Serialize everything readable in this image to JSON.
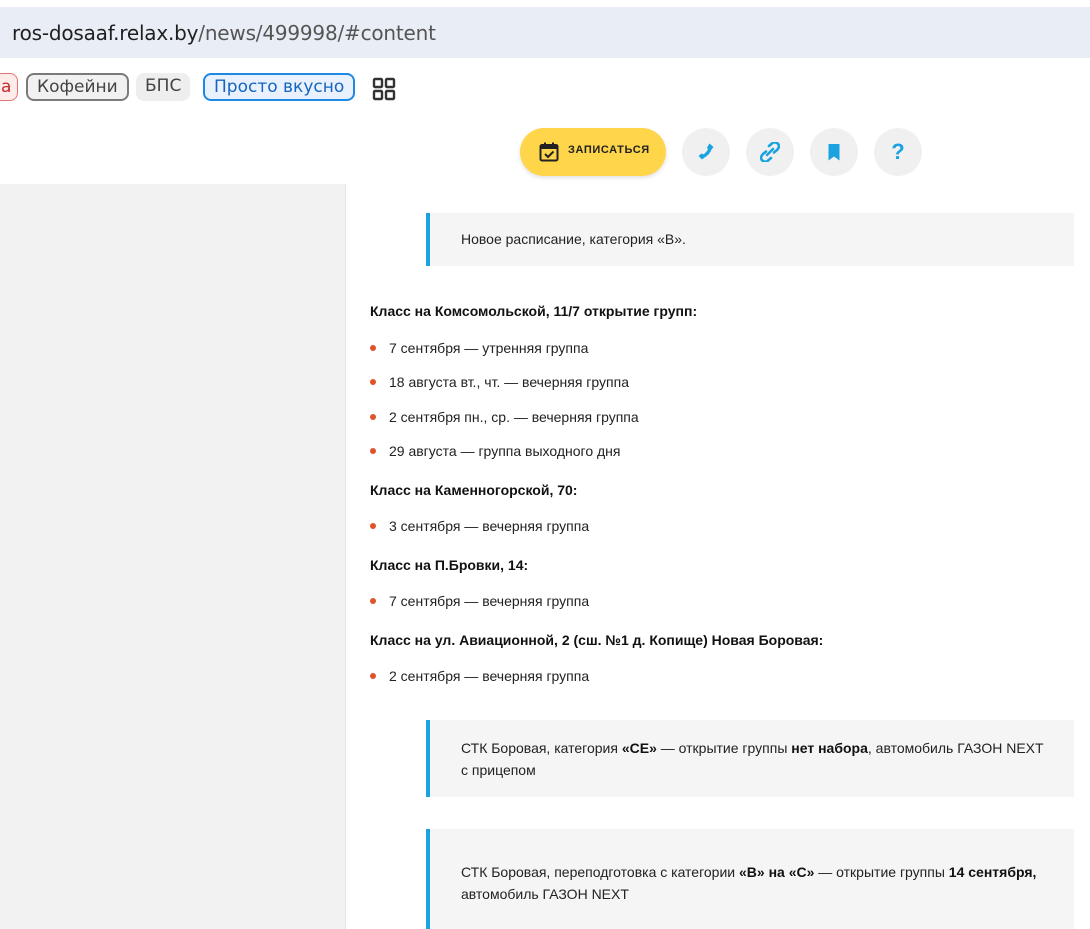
{
  "browser": {
    "url_host": "ros-dosaaf.relax.by",
    "url_path": "/news/499998/#content"
  },
  "tags": {
    "cut_label": "a",
    "items": [
      "Кофейни",
      "БПС",
      "Просто вкусно"
    ]
  },
  "header": {
    "signup_label": "ЗАПИСАТЬСЯ",
    "help_label": "?"
  },
  "article": {
    "intro_quote": "Новое расписание, категория «В».",
    "sections": [
      {
        "heading": "Класс на Комсомольской, 11/7 открытие групп:",
        "items": [
          "7 сентября — утренняя группа",
          "18 августа вт., чт. — вечерняя группа",
          "2 сентября пн., ср. — вечерняя группа",
          "29 августа — группа выходного дня"
        ]
      },
      {
        "heading": "Класс на Каменногорской, 70:",
        "items": [
          "3 сентября — вечерняя группа"
        ]
      },
      {
        "heading": "Класс на П.Бровки, 14:",
        "items": [
          "7 сентября — вечерняя группа"
        ]
      },
      {
        "heading": "Класс на ул. Авиационной, 2 (сш. №1 д. Копище) Новая Боровая:",
        "items": [
          "2 сентября — вечерняя группа"
        ]
      }
    ],
    "quote_ce": {
      "p1": "СТК Боровая, категория ",
      "b1": "«CE»",
      "p2": " — открытие группы ",
      "b2": "нет набора",
      "p3": ", автомобиль ГАЗОН NEXT с прицепом"
    },
    "quote_bc": {
      "p1": "СТК Боровая, переподготовка с категории ",
      "b1": "«В» на «С»",
      "p2": " — открытие группы ",
      "b2": "14 сентября,",
      "p3": " автомобиль ГАЗОН NEXT"
    }
  },
  "colors": {
    "accent_blue": "#1aa3e0",
    "bullet_orange": "#e0532a",
    "signup_yellow": "#ffd54a"
  }
}
